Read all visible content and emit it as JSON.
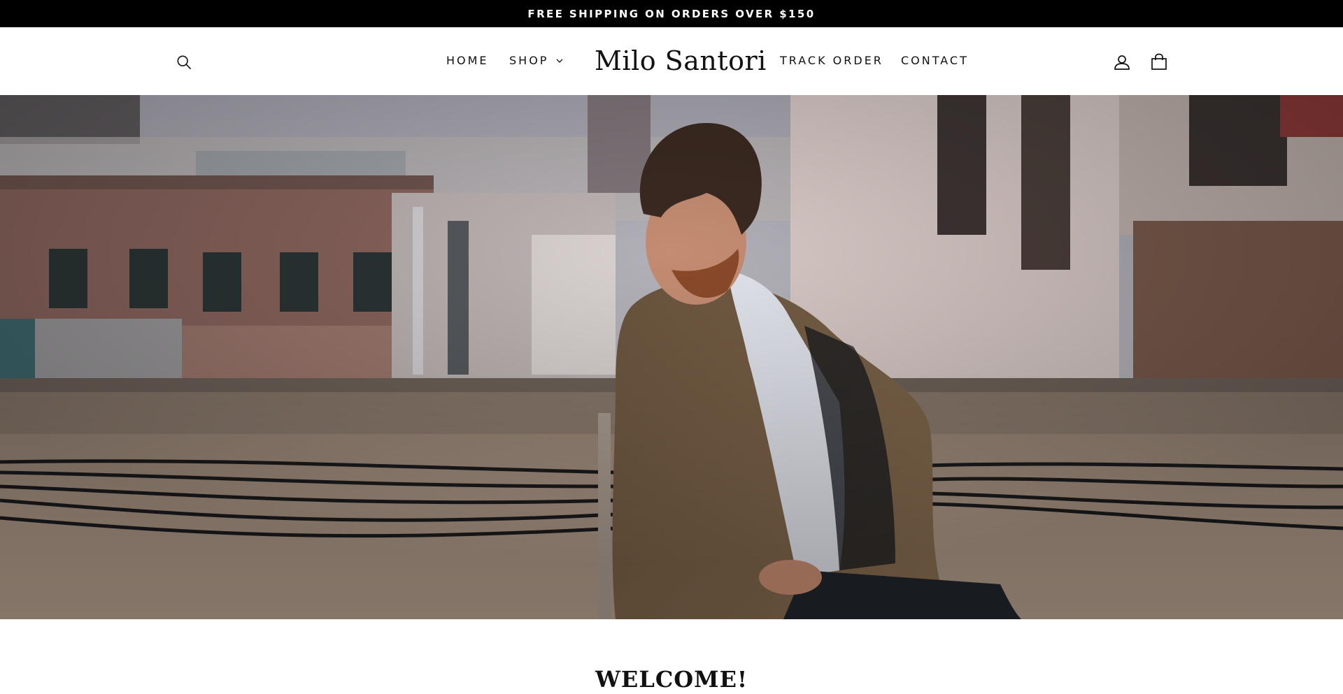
{
  "announcement": {
    "text": "FREE SHIPPING ON ORDERS OVER $150"
  },
  "header": {
    "logo": "Milo Santori",
    "nav_left": [
      {
        "label": "HOME"
      },
      {
        "label": "SHOP",
        "has_dropdown": true
      }
    ],
    "nav_right": [
      {
        "label": "TRACK ORDER"
      },
      {
        "label": "CONTACT"
      }
    ],
    "icons": {
      "search": "search-icon",
      "account": "user-icon",
      "cart": "shopping-bag-icon",
      "dropdown": "chevron-down-icon"
    }
  },
  "hero": {
    "image_alt": "",
    "colors": {
      "sky": "#b9b8c2",
      "wall": "#a38e7d",
      "coat": "#7a6247",
      "shirt": "#e8e9f0",
      "cables": "#1b1b1d"
    }
  },
  "welcome": {
    "heading": "WELCOME!"
  }
}
